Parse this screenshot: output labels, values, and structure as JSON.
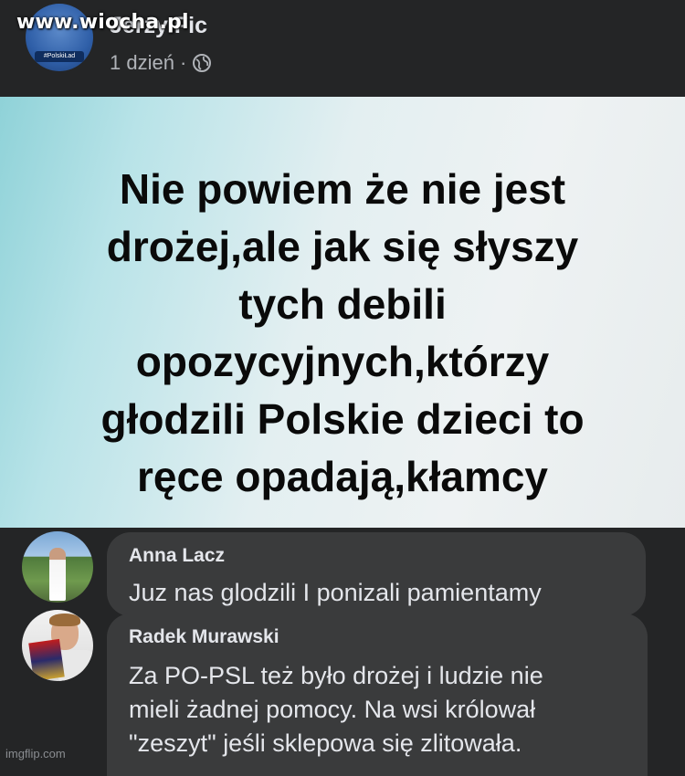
{
  "watermark": "www.wiocha.pl",
  "post": {
    "author": "Jerzy Fic",
    "time": "1 dzień · ",
    "privacy_icon": "globe-icon",
    "avatar_badge": "#PolskiŁad",
    "image_text": "Nie powiem że nie jest\ndrożej,ale jak się słyszy\ntych debili\nopozycyjnych,którzy\ngłodzili Polskie dzieci to\nręce opadają,kłamcy"
  },
  "comments": [
    {
      "author": "Anna Lacz",
      "text": "Juz nas glodzili I ponizali pamientamy"
    },
    {
      "author": "Radek Murawski",
      "text": "Za PO-PSL też było drożej i ludzie nie\nmieli żadnej pomocy. Na wsi królował\n\"zeszyt\" jeśli sklepowa się zlitowała."
    }
  ],
  "footer": {
    "imgflip": "imgflip.com"
  },
  "colors": {
    "background": "#242526",
    "bubble": "#3a3b3c",
    "text_primary": "#e4e6eb",
    "text_secondary": "#b0b3b8"
  }
}
